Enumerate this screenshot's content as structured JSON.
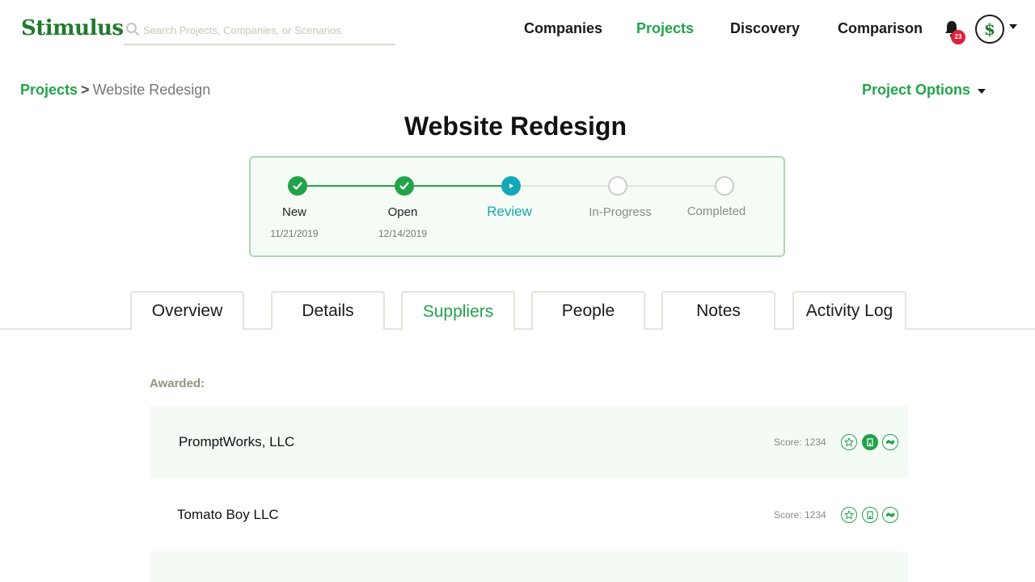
{
  "header": {
    "logo": "Stimulus",
    "search_placeholder": "Search Projects, Companies, or Scenarios",
    "nav": [
      "Companies",
      "Projects",
      "Discovery",
      "Comparison"
    ],
    "active_nav": "Projects",
    "notification_count": "23",
    "avatar_letter": "$"
  },
  "breadcrumb": {
    "parent": "Projects",
    "separator": ">",
    "current": "Website Redesign"
  },
  "project_options_label": "Project Options",
  "page_title": "Website Redesign",
  "stepper": {
    "steps": [
      {
        "label": "New",
        "date": "11/21/2019",
        "state": "done"
      },
      {
        "label": "Open",
        "date": "12/14/2019",
        "state": "done"
      },
      {
        "label": "Review",
        "date": "",
        "state": "current"
      },
      {
        "label": "In-Progress",
        "date": "",
        "state": "todo"
      },
      {
        "label": "Completed",
        "date": "",
        "state": "todo"
      }
    ]
  },
  "tabs": [
    "Overview",
    "Details",
    "Suppliers",
    "People",
    "Notes",
    "Activity Log"
  ],
  "active_tab": "Suppliers",
  "suppliers": {
    "section_label": "Awarded:",
    "rows": [
      {
        "name": "PromptWorks, LLC",
        "score": "Score: 1234",
        "building_filled": true
      },
      {
        "name": "Tomato Boy LLC",
        "score": "Score: 1234",
        "building_filled": false
      }
    ]
  },
  "colors": {
    "brand_green": "#22a34a",
    "current_teal": "#13a8b8",
    "badge_red": "#e0203a"
  }
}
